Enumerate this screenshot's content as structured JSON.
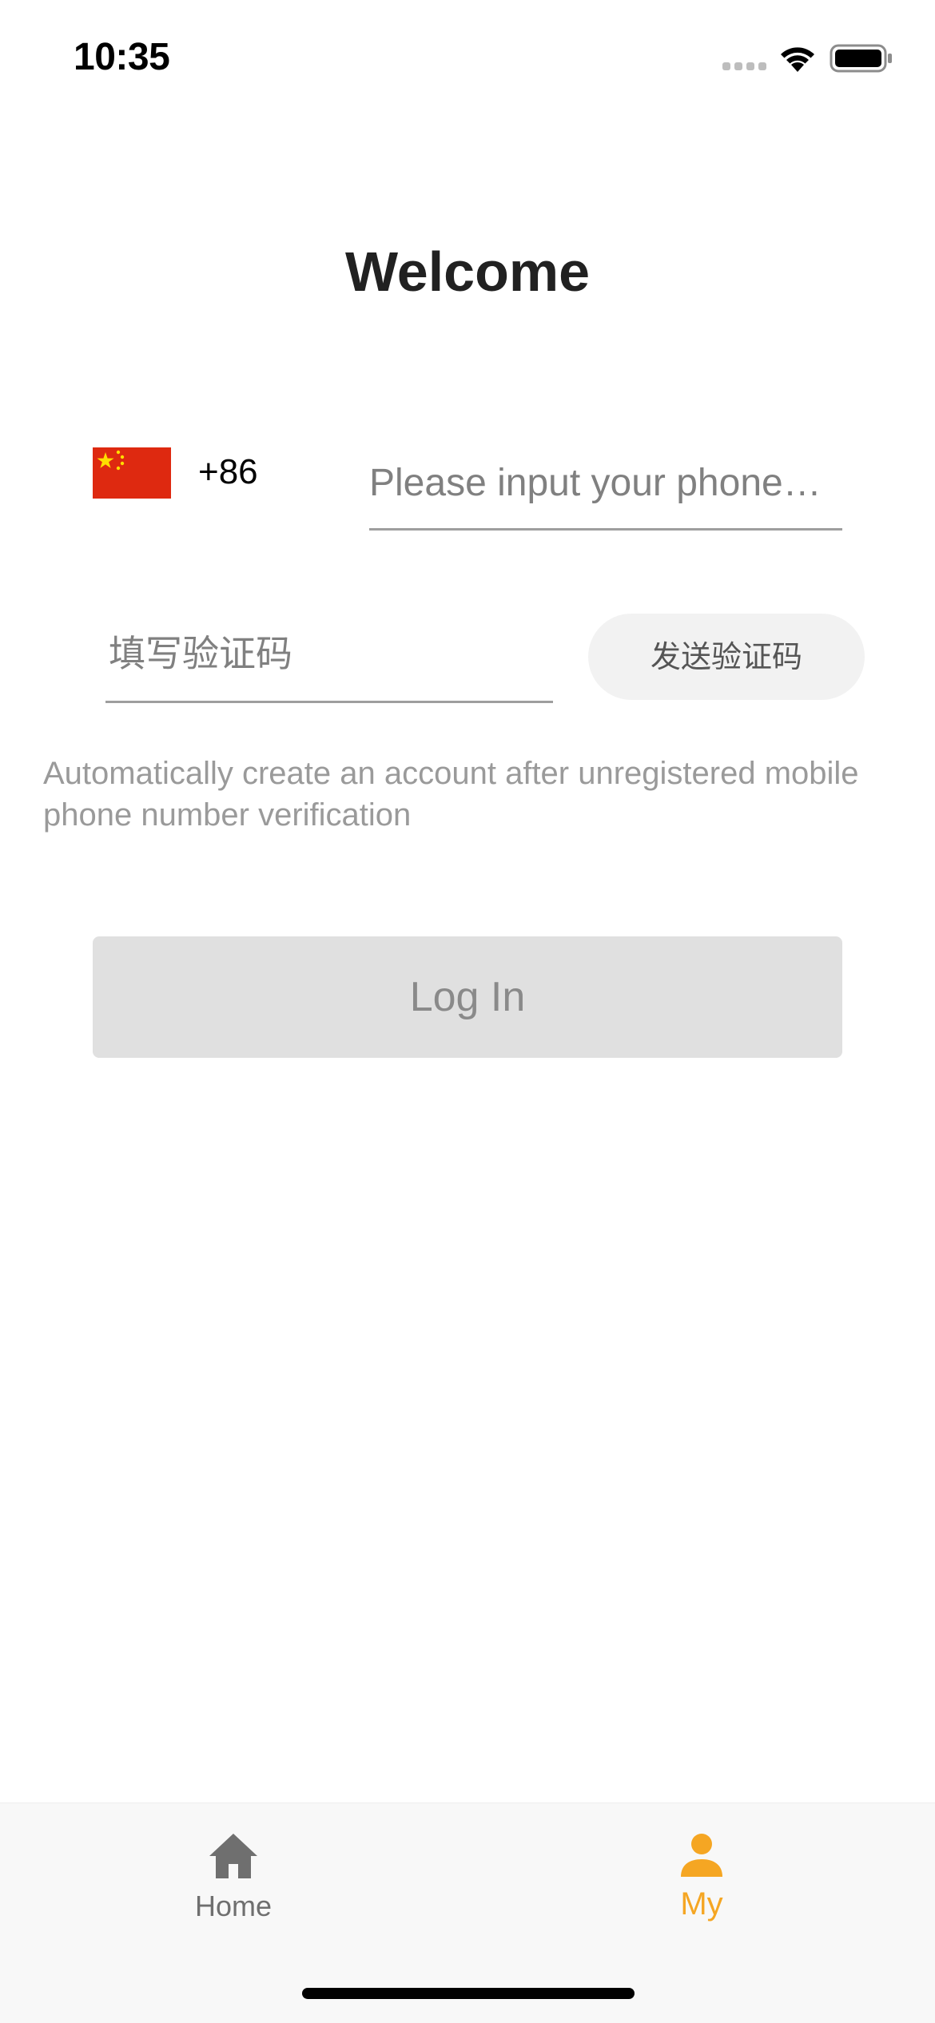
{
  "status_bar": {
    "time": "10:35",
    "icons": [
      "signal-icon",
      "wifi-icon",
      "battery-icon"
    ]
  },
  "title": "Welcome",
  "phone": {
    "flag_icon": "china-flag-icon",
    "country_code": "+86",
    "placeholder": "Please input your phone…",
    "value": ""
  },
  "verification": {
    "placeholder": "填写验证码",
    "value": "",
    "send_button_label": "发送验证码"
  },
  "hint": "Automatically create an account after unregistered mobile phone number verification",
  "login_button_label": "Log In",
  "tab_bar": {
    "items": [
      {
        "label": "Home",
        "icon": "home-icon",
        "active": false
      },
      {
        "label": "My",
        "icon": "person-icon",
        "active": true
      }
    ],
    "active_color": "#f5a623",
    "inactive_color": "#6f6f6f"
  }
}
